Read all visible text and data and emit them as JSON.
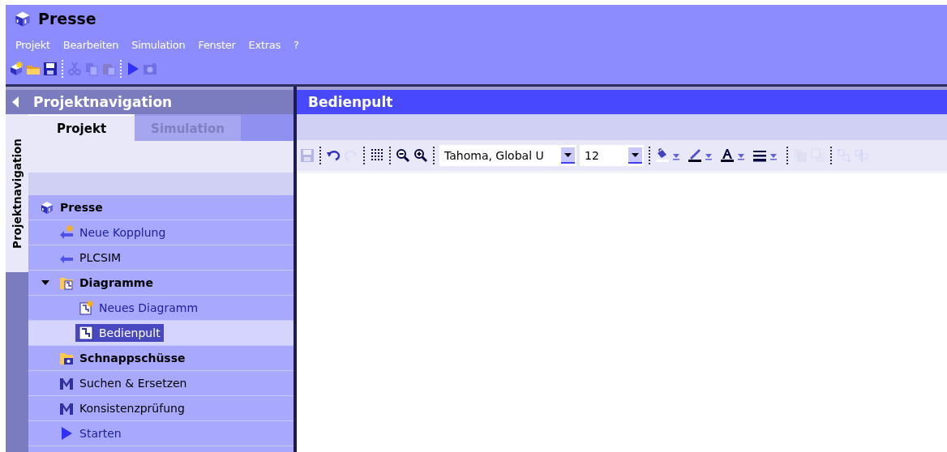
{
  "window": {
    "title": "Presse"
  },
  "menu": [
    "Projekt",
    "Bearbeiten",
    "Simulation",
    "Fenster",
    "Extras",
    "?"
  ],
  "toolbar": [
    {
      "kind": "new",
      "disabled": false
    },
    {
      "kind": "open",
      "disabled": false
    },
    {
      "kind": "save",
      "disabled": false
    },
    {
      "kind": "sep"
    },
    {
      "kind": "cut",
      "disabled": true
    },
    {
      "kind": "copy",
      "disabled": true
    },
    {
      "kind": "paste",
      "disabled": true
    },
    {
      "kind": "sep"
    },
    {
      "kind": "run",
      "disabled": false
    },
    {
      "kind": "camera",
      "disabled": true
    }
  ],
  "navigation": {
    "title": "Projektnavigation",
    "side_tab": "Projektnavigation",
    "tabs": [
      {
        "label": "Projekt",
        "selected": true
      },
      {
        "label": "Simulation",
        "selected": false
      }
    ],
    "tree": [
      {
        "label": "Presse",
        "kind": "project",
        "selected": false,
        "children": [
          {
            "label": "Neue Kopplung",
            "kind": "new-coupling",
            "selected": false
          },
          {
            "label": "PLCSIM",
            "kind": "coupling",
            "selected": false
          },
          {
            "label": "Diagramme",
            "kind": "diagram-folder",
            "selected": false,
            "expanded": true,
            "children": [
              {
                "label": "Neues Diagramm",
                "kind": "new-diagram",
                "selected": false
              },
              {
                "label": "Bedienpult",
                "kind": "diagram",
                "selected": true
              }
            ]
          },
          {
            "label": "Schnappschüsse",
            "kind": "snapshot-folder",
            "selected": false
          },
          {
            "label": "Suchen & Ersetzen",
            "kind": "tool",
            "selected": false
          },
          {
            "label": "Konsistenzprüfung",
            "kind": "tool",
            "selected": false
          },
          {
            "label": "Starten",
            "kind": "run",
            "selected": false
          }
        ]
      }
    ]
  },
  "editor": {
    "title": "Bedienpult",
    "toolbar": [
      {
        "kind": "save",
        "disabled": true
      },
      {
        "kind": "sep"
      },
      {
        "kind": "undo",
        "disabled": false
      },
      {
        "kind": "redo",
        "disabled": true
      },
      {
        "kind": "sep"
      },
      {
        "kind": "grid",
        "disabled": false
      },
      {
        "kind": "sep"
      },
      {
        "kind": "zoom-out",
        "disabled": false
      },
      {
        "kind": "zoom-in",
        "disabled": false
      },
      {
        "kind": "sep"
      },
      {
        "kind": "font",
        "value": "Tahoma, Global U"
      },
      {
        "kind": "size",
        "value": "12"
      },
      {
        "kind": "sep"
      },
      {
        "kind": "fill",
        "disabled": false
      },
      {
        "kind": "line-color",
        "disabled": false
      },
      {
        "kind": "font-color",
        "disabled": false
      },
      {
        "kind": "line-style",
        "disabled": false
      },
      {
        "kind": "sep"
      },
      {
        "kind": "front",
        "disabled": true
      },
      {
        "kind": "back",
        "disabled": true
      },
      {
        "kind": "sep"
      },
      {
        "kind": "group",
        "disabled": true
      },
      {
        "kind": "ungroup",
        "disabled": true
      }
    ]
  }
}
